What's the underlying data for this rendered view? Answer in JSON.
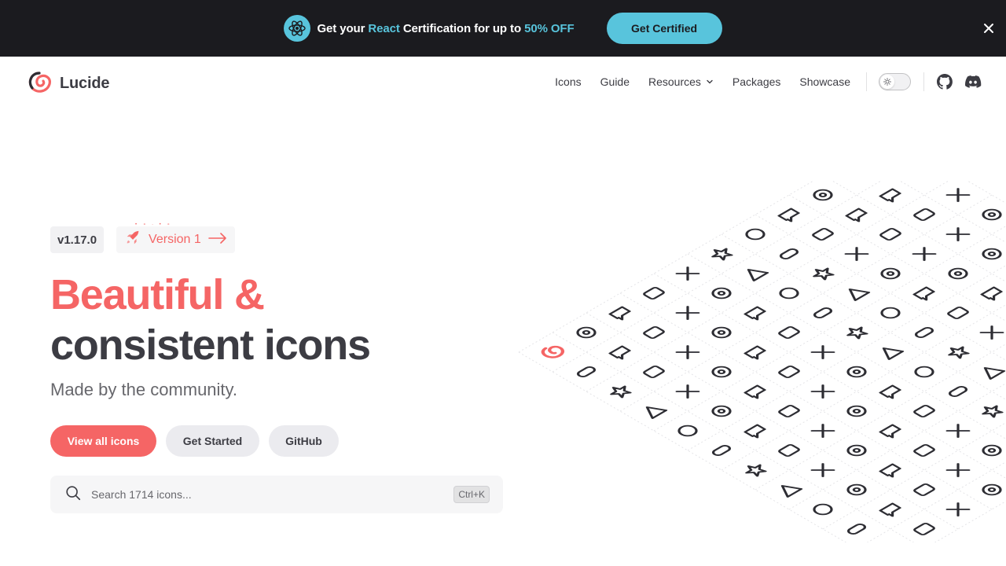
{
  "banner": {
    "text_before": "Get your ",
    "text_highlight1": "React",
    "text_middle": " Certification for up to ",
    "text_highlight2": "50% OFF",
    "cta_label": "Get Certified"
  },
  "nav": {
    "brand": "Lucide",
    "links": [
      "Icons",
      "Guide",
      "Resources",
      "Packages",
      "Showcase"
    ]
  },
  "hero": {
    "version": "v1.17.0",
    "announcement": "Version 1",
    "title_line1": "Beautiful &",
    "title_line2": "consistent icons",
    "subtitle": "Made by the community.",
    "buttons": {
      "primary": "View all icons",
      "get_started": "Get Started",
      "github": "GitHub"
    },
    "search": {
      "placeholder": "Search 1714 icons...",
      "shortcut": "Ctrl+K"
    }
  },
  "colors": {
    "brand_red": "#f56565",
    "banner_bg": "#1b1b1f",
    "react_cyan": "#58c4dc"
  }
}
